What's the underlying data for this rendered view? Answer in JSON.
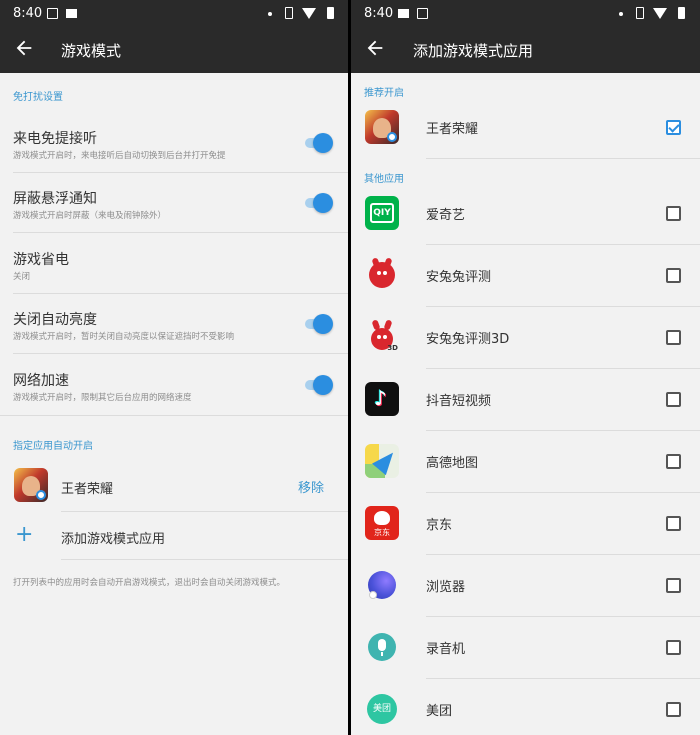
{
  "status_bar": {
    "time_left": "8:40",
    "time_right": "8:40"
  },
  "left_panel": {
    "title": "游戏模式",
    "dnd_section": "免打扰设置",
    "settings": [
      {
        "title": "来电免提接听",
        "subtitle": "游戏模式开启时，来电接听后自动切换到后台并打开免提",
        "toggle": true
      },
      {
        "title": "屏蔽悬浮通知",
        "subtitle": "游戏模式开启时屏蔽（来电及闹钟除外）",
        "toggle": true
      },
      {
        "title": "游戏省电",
        "subtitle": "关闭",
        "toggle": null
      },
      {
        "title": "关闭自动亮度",
        "subtitle": "游戏模式开启时，暂时关闭自动亮度以保证遮挡时不受影响",
        "toggle": true
      },
      {
        "title": "网络加速",
        "subtitle": "游戏模式开启时，限制其它后台应用的网络速度",
        "toggle": true
      }
    ],
    "auto_section": "指定应用自动开启",
    "assigned_app": {
      "name": "王者荣耀",
      "action": "移除"
    },
    "add_label": "添加游戏模式应用",
    "footer": "打开列表中的应用时会自动开启游戏模式，退出时会自动关闭游戏模式。"
  },
  "right_panel": {
    "title": "添加游戏模式应用",
    "recommended_section": "推荐开启",
    "other_section": "其他应用",
    "apps": [
      {
        "name": "王者荣耀",
        "icon": "honor-of-kings-icon",
        "checked": true
      },
      {
        "name": "爱奇艺",
        "icon": "iqiyi-icon",
        "checked": false,
        "icon_text": "QIY"
      },
      {
        "name": "安兔兔评测",
        "icon": "antutu-icon",
        "checked": false
      },
      {
        "name": "安兔兔评测3D",
        "icon": "antutu-3d-icon",
        "checked": false
      },
      {
        "name": "抖音短视频",
        "icon": "douyin-icon",
        "checked": false
      },
      {
        "name": "高德地图",
        "icon": "amap-icon",
        "checked": false
      },
      {
        "name": "京东",
        "icon": "jd-icon",
        "checked": false,
        "icon_text": "京东"
      },
      {
        "name": "浏览器",
        "icon": "browser-icon",
        "checked": false
      },
      {
        "name": "录音机",
        "icon": "recorder-icon",
        "checked": false
      },
      {
        "name": "美团",
        "icon": "meituan-icon",
        "checked": false,
        "icon_text": "美团"
      }
    ]
  },
  "colors": {
    "accent": "#2b8ee0",
    "section_header": "#3b97cf",
    "app_bar": "#2a2a2a"
  }
}
